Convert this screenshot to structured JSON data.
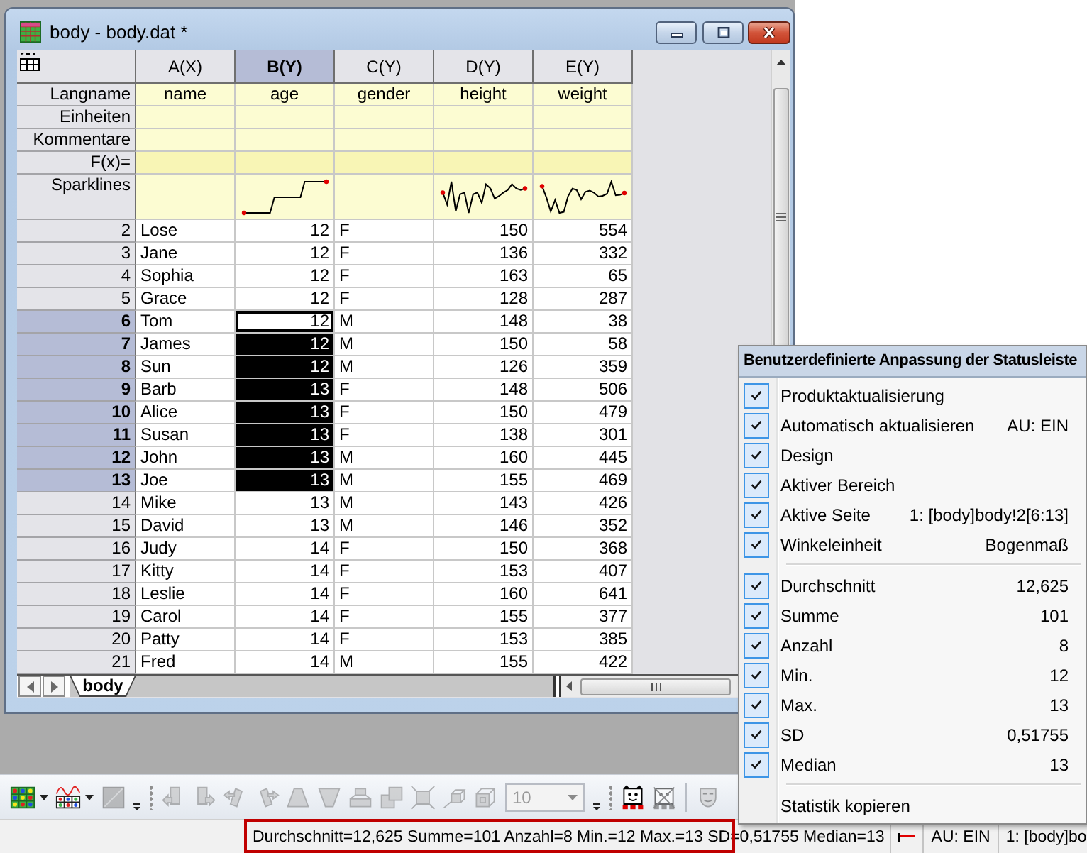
{
  "window": {
    "title": "body - body.dat *"
  },
  "worksheet": {
    "columns": [
      {
        "label": "A(X)",
        "kind": "text",
        "selected": false,
        "sparkline": false
      },
      {
        "label": "B(Y)",
        "kind": "number",
        "selected": true,
        "sparkline": true
      },
      {
        "label": "C(Y)",
        "kind": "text",
        "selected": false,
        "sparkline": false
      },
      {
        "label": "D(Y)",
        "kind": "number",
        "selected": false,
        "sparkline": true
      },
      {
        "label": "E(Y)",
        "kind": "number",
        "selected": false,
        "sparkline": true
      }
    ],
    "header_rows": [
      {
        "label": "Langname",
        "kind": "text",
        "cells": [
          "name",
          "age",
          "gender",
          "height",
          "weight"
        ]
      },
      {
        "label": "Einheiten",
        "kind": "text"
      },
      {
        "label": "Kommentare",
        "kind": "text"
      },
      {
        "label": "F(x)=",
        "kind": "formula"
      },
      {
        "label": "Sparklines",
        "kind": "sparkline"
      }
    ],
    "rows": [
      {
        "number": "2",
        "selected": false,
        "active": false,
        "cells": [
          "Lose",
          "12",
          "F",
          "150",
          "554"
        ]
      },
      {
        "number": "3",
        "selected": false,
        "active": false,
        "cells": [
          "Jane",
          "12",
          "F",
          "136",
          "332"
        ]
      },
      {
        "number": "4",
        "selected": false,
        "active": false,
        "cells": [
          "Sophia",
          "12",
          "F",
          "163",
          "65"
        ]
      },
      {
        "number": "5",
        "selected": false,
        "active": false,
        "cells": [
          "Grace",
          "12",
          "F",
          "128",
          "287"
        ]
      },
      {
        "number": "6",
        "selected": true,
        "active": true,
        "cells": [
          "Tom",
          "12",
          "M",
          "148",
          "38"
        ]
      },
      {
        "number": "7",
        "selected": true,
        "active": false,
        "cells": [
          "James",
          "12",
          "M",
          "150",
          "58"
        ]
      },
      {
        "number": "8",
        "selected": true,
        "active": false,
        "cells": [
          "Sun",
          "12",
          "M",
          "126",
          "359"
        ]
      },
      {
        "number": "9",
        "selected": true,
        "active": false,
        "cells": [
          "Barb",
          "13",
          "F",
          "148",
          "506"
        ]
      },
      {
        "number": "10",
        "selected": true,
        "active": false,
        "cells": [
          "Alice",
          "13",
          "F",
          "150",
          "479"
        ]
      },
      {
        "number": "11",
        "selected": true,
        "active": false,
        "cells": [
          "Susan",
          "13",
          "F",
          "138",
          "301"
        ]
      },
      {
        "number": "12",
        "selected": true,
        "active": false,
        "cells": [
          "John",
          "13",
          "M",
          "160",
          "445"
        ]
      },
      {
        "number": "13",
        "selected": true,
        "active": false,
        "cells": [
          "Joe",
          "13",
          "M",
          "155",
          "469"
        ]
      },
      {
        "number": "14",
        "selected": false,
        "active": false,
        "cells": [
          "Mike",
          "13",
          "M",
          "143",
          "426"
        ]
      },
      {
        "number": "15",
        "selected": false,
        "active": false,
        "cells": [
          "David",
          "13",
          "M",
          "146",
          "352"
        ]
      },
      {
        "number": "16",
        "selected": false,
        "active": false,
        "cells": [
          "Judy",
          "14",
          "F",
          "150",
          "368"
        ]
      },
      {
        "number": "17",
        "selected": false,
        "active": false,
        "cells": [
          "Kitty",
          "14",
          "F",
          "153",
          "407"
        ]
      },
      {
        "number": "18",
        "selected": false,
        "active": false,
        "cells": [
          "Leslie",
          "14",
          "F",
          "160",
          "641"
        ]
      },
      {
        "number": "19",
        "selected": false,
        "active": false,
        "cells": [
          "Carol",
          "14",
          "F",
          "155",
          "377"
        ]
      },
      {
        "number": "20",
        "selected": false,
        "active": false,
        "cells": [
          "Patty",
          "14",
          "F",
          "153",
          "385"
        ]
      },
      {
        "number": "21",
        "selected": false,
        "active": false,
        "cells": [
          "Fred",
          "14",
          "M",
          "155",
          "422"
        ]
      }
    ],
    "sheet_tabs": [
      {
        "label": "body",
        "selected": true
      }
    ]
  },
  "toolbar": {
    "tools": [
      {
        "kind": "worksheet",
        "disabled": false,
        "dropdown": true
      },
      {
        "kind": "plot",
        "disabled": false,
        "dropdown": true
      },
      {
        "kind": "square",
        "disabled": true,
        "dropdown": false
      },
      {
        "kind": "overflow"
      },
      {
        "kind": "grip"
      },
      {
        "kind": "rotate-left",
        "disabled": true,
        "dropdown": false
      },
      {
        "kind": "rotate-right",
        "disabled": true,
        "dropdown": false
      },
      {
        "kind": "tilt-left",
        "disabled": true,
        "dropdown": false
      },
      {
        "kind": "tilt-right",
        "disabled": true,
        "dropdown": false
      },
      {
        "kind": "trapezoid",
        "disabled": true,
        "dropdown": false
      },
      {
        "kind": "funnel",
        "disabled": true,
        "dropdown": false
      },
      {
        "kind": "frame",
        "disabled": true,
        "dropdown": false
      },
      {
        "kind": "layers",
        "disabled": true,
        "dropdown": false
      },
      {
        "kind": "expand",
        "disabled": true,
        "dropdown": false
      },
      {
        "kind": "cube-small",
        "disabled": true,
        "dropdown": false
      },
      {
        "kind": "cube",
        "disabled": true,
        "dropdown": false
      },
      {
        "kind": "field",
        "value": "10",
        "disabled": true
      },
      {
        "kind": "overflow"
      },
      {
        "kind": "grip"
      },
      {
        "kind": "face",
        "disabled": false,
        "dropdown": false
      },
      {
        "kind": "face-crossed",
        "disabled": true,
        "dropdown": false
      },
      {
        "kind": "separator"
      },
      {
        "kind": "mask",
        "disabled": true,
        "dropdown": false
      }
    ]
  },
  "status_bar": {
    "panels": [
      {
        "kind": "text",
        "text": "Durchschnitt=12,625 Summe=101 Anzahl=8 Min.=12 Max.=13 SD=0,51755 Median=13",
        "highlighted": true
      },
      {
        "kind": "marker"
      },
      {
        "kind": "text",
        "text": "AU: EIN",
        "highlighted": false
      },
      {
        "kind": "text",
        "text": "1: [body]bo",
        "highlighted": false
      }
    ]
  },
  "context_menu": {
    "title": "Benutzerdefinierte Anpassung der Statusleiste",
    "items": [
      {
        "kind": "check",
        "label": "Produktaktualisierung",
        "checked": true
      },
      {
        "kind": "check",
        "label": "Automatisch aktualisieren",
        "value": "AU: EIN",
        "checked": true
      },
      {
        "kind": "check",
        "label": "Design",
        "checked": true
      },
      {
        "kind": "check",
        "label": "Aktiver Bereich",
        "checked": true
      },
      {
        "kind": "check",
        "label": "Aktive Seite",
        "value": "1: [body]body!2[6:13]",
        "checked": true
      },
      {
        "kind": "check",
        "label": "Winkeleinheit",
        "value": "Bogenmaß",
        "checked": true
      },
      {
        "kind": "separator"
      },
      {
        "kind": "check",
        "label": "Durchschnitt",
        "value": "12,625",
        "checked": true
      },
      {
        "kind": "check",
        "label": "Summe",
        "value": "101",
        "checked": true
      },
      {
        "kind": "check",
        "label": "Anzahl",
        "value": "8",
        "checked": true
      },
      {
        "kind": "check",
        "label": "Min.",
        "value": "12",
        "checked": true
      },
      {
        "kind": "check",
        "label": "Max.",
        "value": "13",
        "checked": true
      },
      {
        "kind": "check",
        "label": "SD",
        "value": "0,51755",
        "checked": true
      },
      {
        "kind": "check",
        "label": "Median",
        "value": "13",
        "checked": true
      },
      {
        "kind": "separator"
      },
      {
        "kind": "command",
        "label": "Statistik kopieren"
      }
    ]
  }
}
